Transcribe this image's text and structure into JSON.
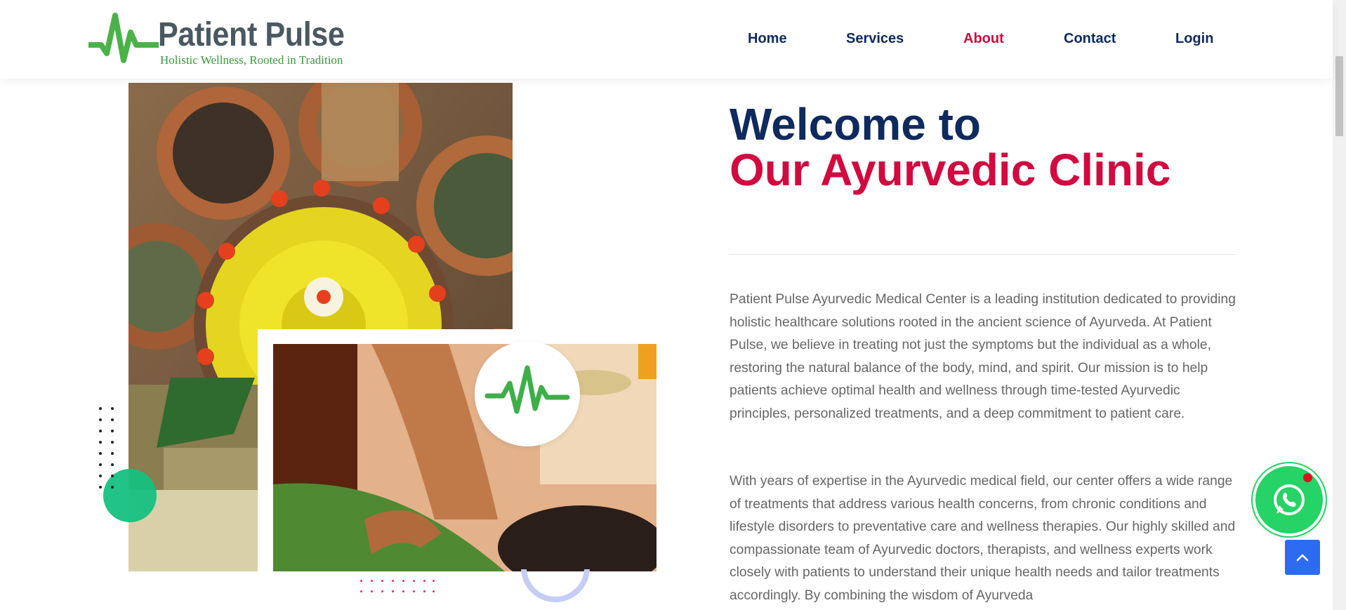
{
  "header": {
    "brand": "Patient Pulse",
    "tagline": "Holistic Wellness, Rooted in Tradition",
    "nav": [
      {
        "label": "Home"
      },
      {
        "label": "Services"
      },
      {
        "label": "About"
      },
      {
        "label": "Contact"
      },
      {
        "label": "Login"
      }
    ],
    "active_nav": "About"
  },
  "hero": {
    "title_line1": "Welcome to",
    "title_line2": "Our Ayurvedic Clinic",
    "paragraph1": "Patient Pulse Ayurvedic Medical Center is a leading institution dedicated to providing holistic healthcare solutions rooted in the ancient science of Ayurveda. At Patient Pulse, we believe in treating not just the symptoms but the individual as a whole, restoring the natural balance of the body, mind, and spirit. Our mission is to help patients achieve optimal health and wellness through time-tested Ayurvedic principles, personalized treatments, and a deep commitment to patient care.",
    "paragraph2": "With years of expertise in the Ayurvedic medical field, our center offers a wide range of treatments that address various health concerns, from chronic conditions and lifestyle disorders to preventative care and wellness therapies. Our highly skilled and compassionate team of Ayurvedic doctors, therapists, and wellness experts work closely with patients to understand their unique health needs and tailor treatments accordingly. By combining the wisdom of Ayurveda"
  },
  "icons": {
    "logo": "pulse-logo-icon",
    "badge": "heartbeat-icon",
    "whatsapp": "whatsapp-icon",
    "scroll_top": "chevron-up-icon"
  },
  "colors": {
    "navy": "#0e2a5e",
    "crimson": "#d10a3f",
    "green": "#3b9a3a",
    "whatsapp": "#25d366",
    "scroll_top": "#2d6cf0"
  }
}
